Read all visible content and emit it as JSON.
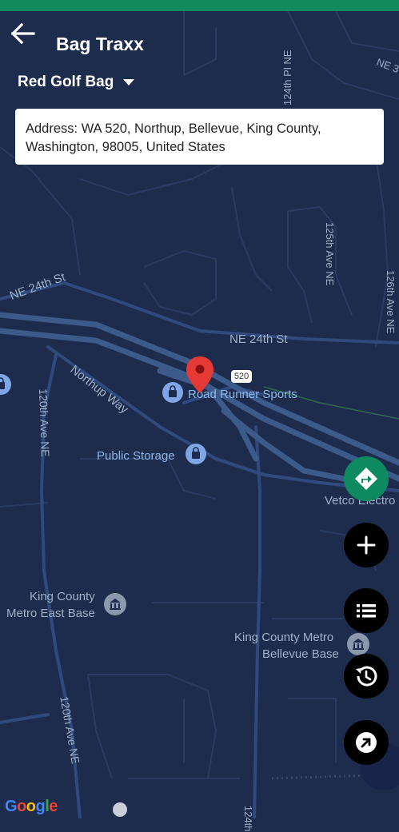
{
  "app": {
    "title": "Bag Traxx"
  },
  "bag_selector": {
    "selected": "Red Golf Bag"
  },
  "address": {
    "text": "Address: WA 520, Northup, Bellevue, King County, Washington, 98005, United States"
  },
  "map": {
    "streets": {
      "ne24_left": "NE 24th St",
      "ne24_right": "NE 24th St",
      "northup": "Northup Way",
      "ave120_top": "120th Ave NE",
      "ave120_bottom": "120th Ave NE",
      "ave124_top": "124th Pl NE",
      "ave125": "125th Ave NE",
      "ave126": "126th Ave NE",
      "ne3": "NE 3",
      "ave124_bottom": "124th",
      "highway_shield": "520"
    },
    "pois": {
      "road_runner": "Road Runner Sports",
      "public_storage": "Public Storage",
      "vetco": "Vetco Electro",
      "king_county_metro_east_1": "King County",
      "king_county_metro_east_2": "Metro East Base",
      "kc_bellevue_1": "King County Metro",
      "kc_bellevue_2": "Bellevue Base"
    },
    "attribution": "Google",
    "colors": {
      "background": "#1d2c4d",
      "roads": "#304a7d",
      "highway": "#3c5a8a",
      "marker": "#e53935",
      "statusbar": "#128a5c"
    }
  },
  "fabs": {
    "directions": "directions-icon",
    "add": "plus-icon",
    "list": "list-icon",
    "history": "history-icon",
    "open": "arrow-up-right-icon"
  }
}
